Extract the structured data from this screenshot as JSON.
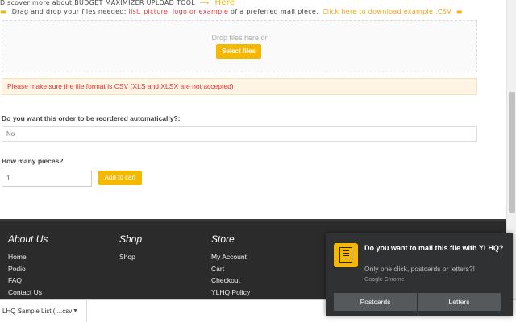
{
  "header": {
    "line1_text": "Discover more about BUDGET MAXIMIZER UPLOAD TOOL",
    "line1_here": "Here",
    "line2_prefix": "Drag and drop your files needed:",
    "line2_red": "list, picture, logo or example",
    "line2_suffix": "of a preferred mail piece.",
    "line2_link": "Click here to download example .CSV"
  },
  "dropzone": {
    "text": "Drop files here or",
    "select_label": "Select files"
  },
  "warning": "Please make sure the file format is CSV (XLS and XLSX are not accepted)",
  "form": {
    "reorder_label": "Do you want this order to be reordered automatically?:",
    "reorder_value": "No",
    "pieces_label": "How many pieces?",
    "pieces_value": "1",
    "add_to_cart": "Add to cart"
  },
  "footer": {
    "about": {
      "title": "About Us",
      "links": [
        "Home",
        "Podio",
        "FAQ",
        "Contact Us"
      ]
    },
    "shop": {
      "title": "Shop",
      "links": [
        "Shop"
      ]
    },
    "store": {
      "title": "Store",
      "links": [
        "My Account",
        "Cart",
        "Checkout",
        "YLHQ Policy"
      ]
    }
  },
  "download_bar": {
    "file": "LHQ Sample List (....csv"
  },
  "notification": {
    "title": "Do you want to mail this file with YLHQ?",
    "body": "Only one click, postcards or letters?!",
    "source": "Google Chrome",
    "button1": "Postcards",
    "button2": "Letters",
    "icon_color": "#f5b800"
  },
  "colors": {
    "accent": "#f5b800",
    "footer_bg": "#2b2b2b",
    "warning_text": "#d9383a"
  }
}
